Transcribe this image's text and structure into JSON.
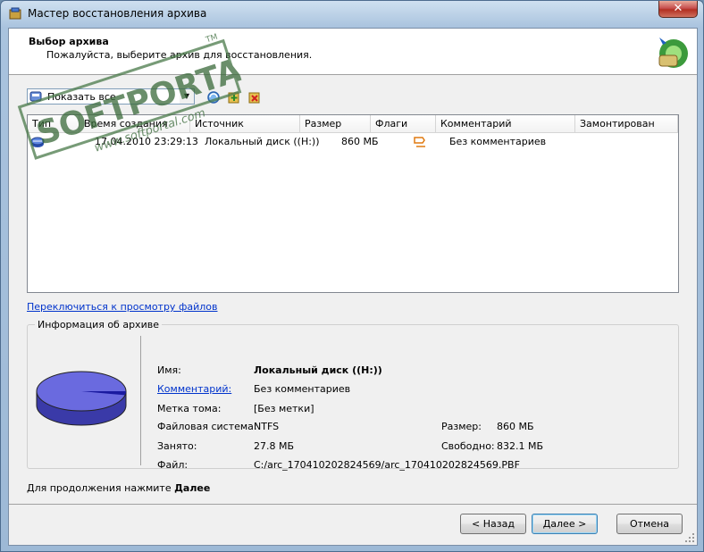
{
  "window": {
    "title": "Мастер восстановления архива"
  },
  "header": {
    "title": "Выбор архива",
    "subtitle": "Пожалуйста, выберите архив для восстановления."
  },
  "toolbar": {
    "filter_value": "Показать все"
  },
  "table": {
    "columns": [
      "Тип",
      "Время создания",
      "Источник",
      "Размер",
      "Флаги",
      "Комментарий",
      "Замонтирован"
    ],
    "rows": [
      {
        "created": "17.04.2010 23:29:13",
        "source": "Локальный диск ((H:))",
        "size": "860 МБ",
        "comment": "Без комментариев",
        "mounted": ""
      }
    ]
  },
  "switch_link": "Переключиться к просмотру файлов",
  "info": {
    "legend": "Информация об архиве",
    "name_label": "Имя:",
    "name_value": "Локальный диск ((H:))",
    "comment_label": "Комментарий:",
    "comment_value": "Без комментариев",
    "volume_label": "Метка тома:",
    "volume_value": "[Без метки]",
    "fs_label": "Файловая система:",
    "fs_value": "NTFS",
    "used_label": "Занято:",
    "used_value": "27.8 МБ",
    "file_label": "Файл:",
    "file_value": "C:/arc_170410202824569/arc_170410202824569.PBF",
    "size_label": "Размер:",
    "size_value": "860 МБ",
    "free_label": "Свободно:",
    "free_value": "832.1 МБ",
    "used_fraction": 0.032
  },
  "continue": {
    "prefix": "Для продолжения нажмите ",
    "bold": "Далее"
  },
  "buttons": {
    "back": "< Назад",
    "next": "Далее >",
    "cancel": "Отмена"
  },
  "watermark": {
    "brand": "SOFTPORTAL",
    "url": "www.softportal.com",
    "tm": "TM"
  },
  "colors": {
    "pie_fill": "#6a6adf",
    "link": "#0033cc",
    "used_slice": "#1a1aa0"
  }
}
